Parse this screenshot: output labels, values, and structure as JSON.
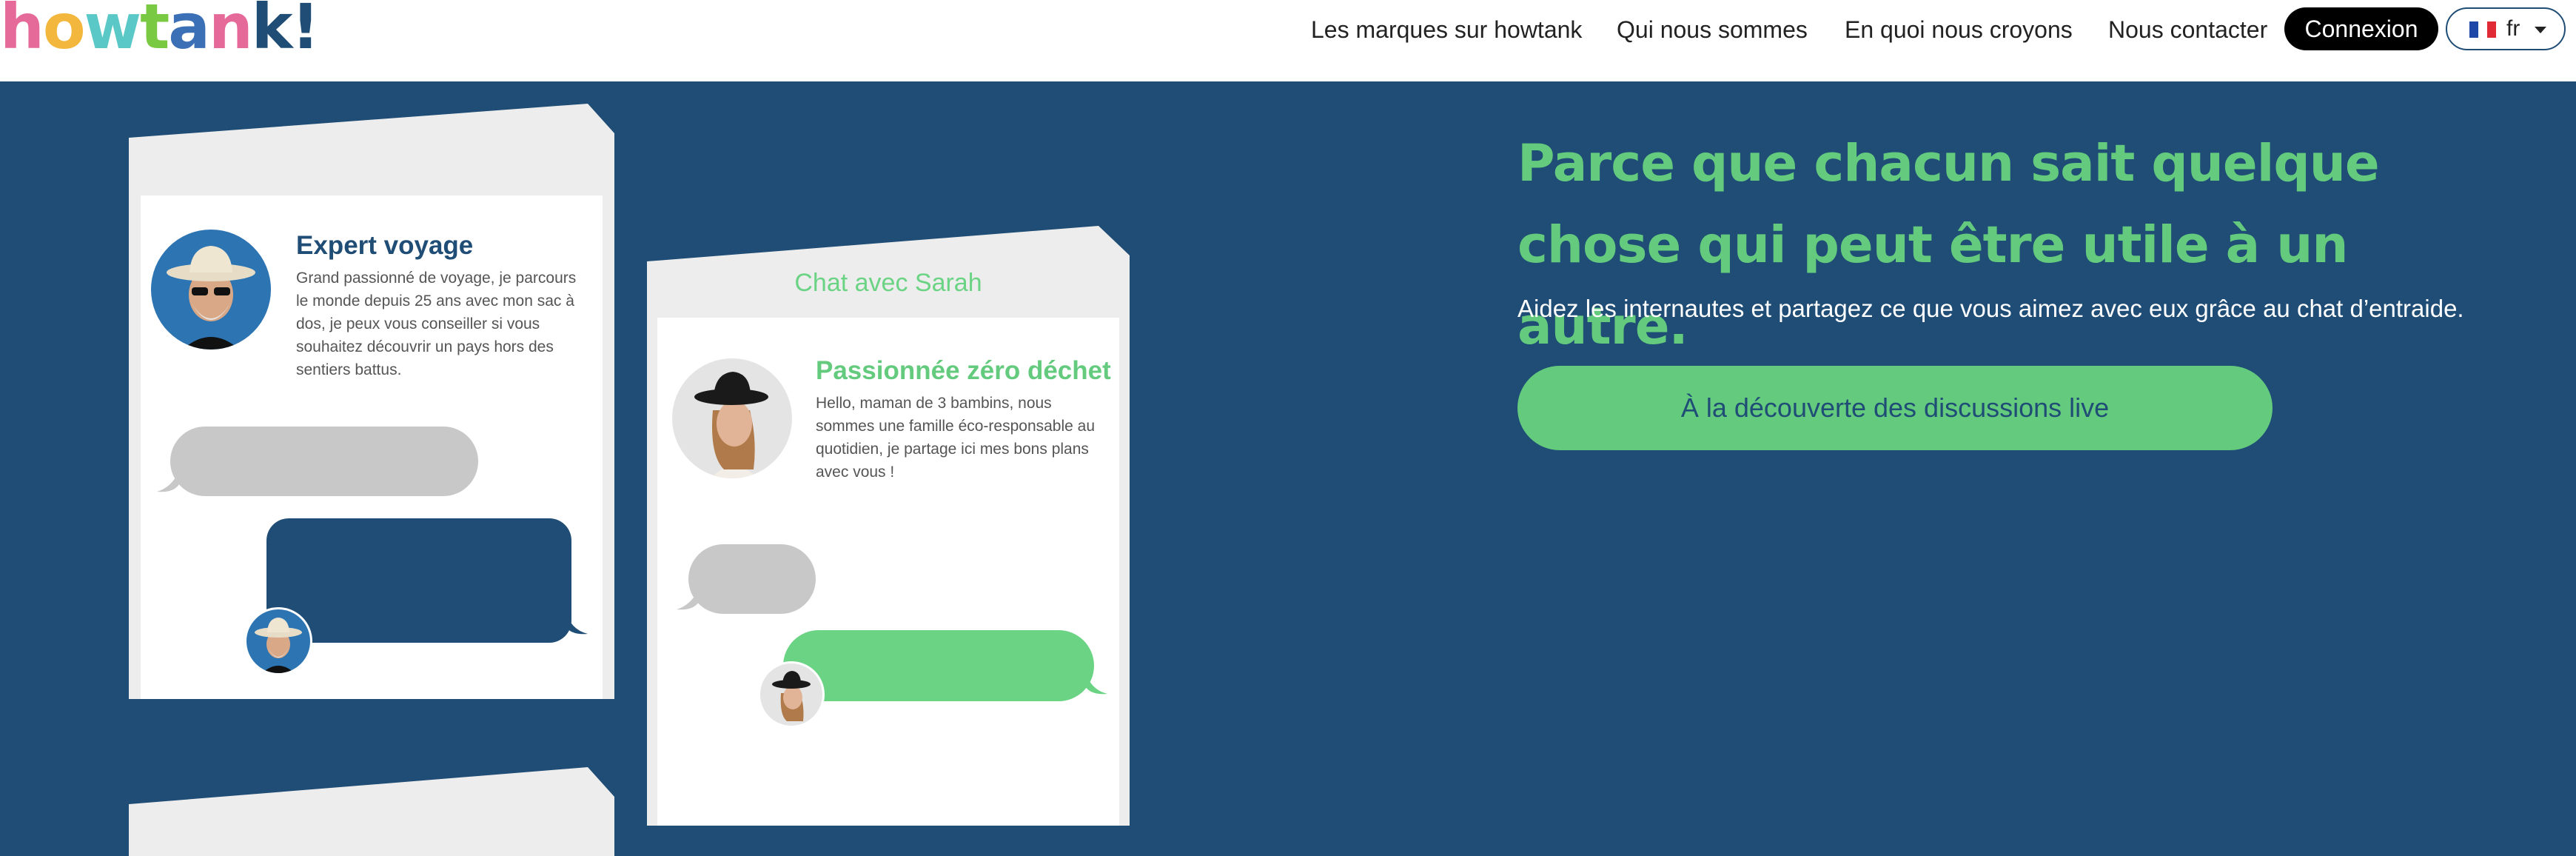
{
  "brand": {
    "logo_text": "howtank!",
    "logo_letters": [
      "h",
      "o",
      "w",
      "t",
      "a",
      "n",
      "k",
      "!"
    ],
    "colors": {
      "navy": "#1f4d75",
      "green": "#64cb7e",
      "pink": "#e56a9a",
      "yellow": "#f2b73c",
      "teal": "#59c8c6"
    }
  },
  "nav": {
    "links": [
      "Les marques sur howtank",
      "Qui nous sommes",
      "En quoi nous croyons",
      "Nous contacter"
    ],
    "login_label": "Connexion",
    "language": {
      "code": "fr",
      "flag": "french-flag-icon"
    }
  },
  "hero": {
    "headline": "Parce que chacun sait quelque chose qui peut être utile à un autre.",
    "subtitle": "Aidez les internautes et partagez ce que vous aimez avec eux grâce au chat d’entraide.",
    "cta_label": "À la découverte des discussions live"
  },
  "cards": [
    {
      "chat_title": "",
      "profile_title": "Expert voyage",
      "profile_desc": "Grand passionné de voyage, je parcours le monde depuis 25 ans avec mon sac à dos, je peux vous conseiller si vous souhaitez découvrir un pays hors des sentiers battus.",
      "avatar": "man-with-hat-avatar"
    },
    {
      "chat_title": "Chat avec Sarah",
      "profile_title": "Passionnée zéro déchet",
      "profile_desc": "Hello, maman de 3 bambins, nous sommes une famille éco-responsable au quotidien, je partage ici mes bons plans avec vous !",
      "avatar": "woman-with-hat-avatar"
    }
  ]
}
